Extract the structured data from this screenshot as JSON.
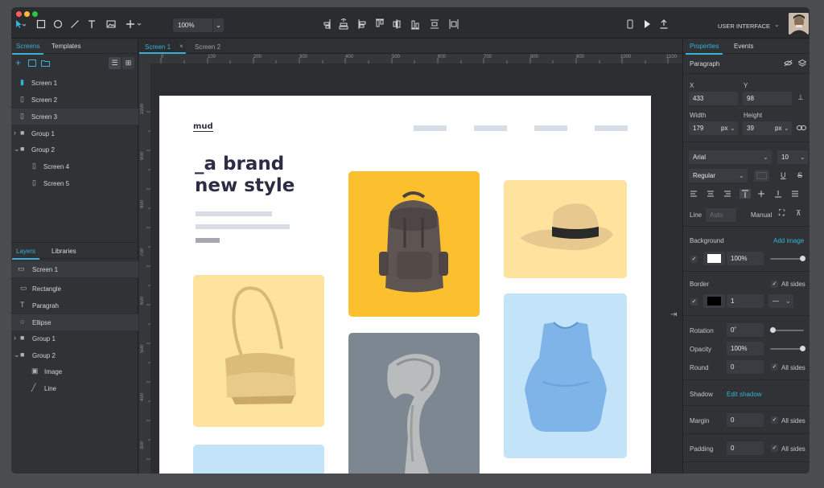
{
  "toolbar": {
    "zoom_value": "100%",
    "project_label": "USER INTERFACE",
    "icons": [
      "pointer-icon",
      "rectangle-icon",
      "ellipse-icon",
      "line-icon",
      "text-icon",
      "image-icon",
      "add-icon",
      "align-icons",
      "phone-preview-icon",
      "play-icon",
      "share-icon"
    ]
  },
  "left_panel": {
    "tabs": [
      "Screens",
      "Templates"
    ],
    "screens": [
      "Screen 1",
      "Screen 2",
      "Screen 3",
      "Group 1",
      "Group 2",
      "Screen 4",
      "Screen 5"
    ],
    "layer_tabs": [
      "Layers",
      "Libraries"
    ],
    "layers": [
      "Screen 1",
      "Rectangle",
      "Paragrah",
      "Ellipse",
      "Group 1",
      "Group 2",
      "Image",
      "Line"
    ]
  },
  "canvas": {
    "tabs": [
      "Screen 1",
      "Screen 2"
    ],
    "ruler_h": [
      "0",
      "100",
      "200",
      "300",
      "400",
      "500",
      "600",
      "700",
      "800",
      "900",
      "1000",
      "1100"
    ],
    "ruler_v": [
      "1000",
      "900",
      "800",
      "700",
      "600",
      "500",
      "400",
      "300",
      "200",
      "100"
    ],
    "artboard": {
      "logo": "mud",
      "headline_line1": "_a brand",
      "headline_line2": "new style"
    }
  },
  "right_panel": {
    "tabs": [
      "Properties",
      "Events"
    ],
    "element_name": "Paragraph",
    "x_label": "X",
    "x_value": "433",
    "y_label": "Y",
    "y_value": "98",
    "width_label": "Width",
    "width_value": "179",
    "width_unit": "px",
    "height_label": "Height",
    "height_value": "39",
    "height_unit": "px",
    "font_family": "Arial",
    "font_size": "10",
    "font_weight": "Regular",
    "line_label": "Line",
    "line_value": "Auto",
    "manual_label": "Manual",
    "background_label": "Background",
    "add_image_label": "Add image",
    "background_opacity": "100%",
    "background_color": "#ffffff",
    "border_label": "Border",
    "all_sides_label": "All sides",
    "border_width": "1",
    "border_color": "#000000",
    "rotation_label": "Rotation",
    "rotation_value": "0˚",
    "opacity_label": "Opacity",
    "opacity_value": "100%",
    "round_label": "Round",
    "round_value": "0",
    "shadow_label": "Shadow",
    "edit_shadow_label": "Edit shadow",
    "margin_label": "Margin",
    "margin_value": "0",
    "padding_label": "Padding",
    "padding_value": "0"
  },
  "colors": {
    "accent": "#35b3d6",
    "card_yellow": "#fcc02e",
    "card_pale_yellow": "#fde39e",
    "card_blue": "#c3e3f8",
    "card_grey": "#7c8791"
  }
}
